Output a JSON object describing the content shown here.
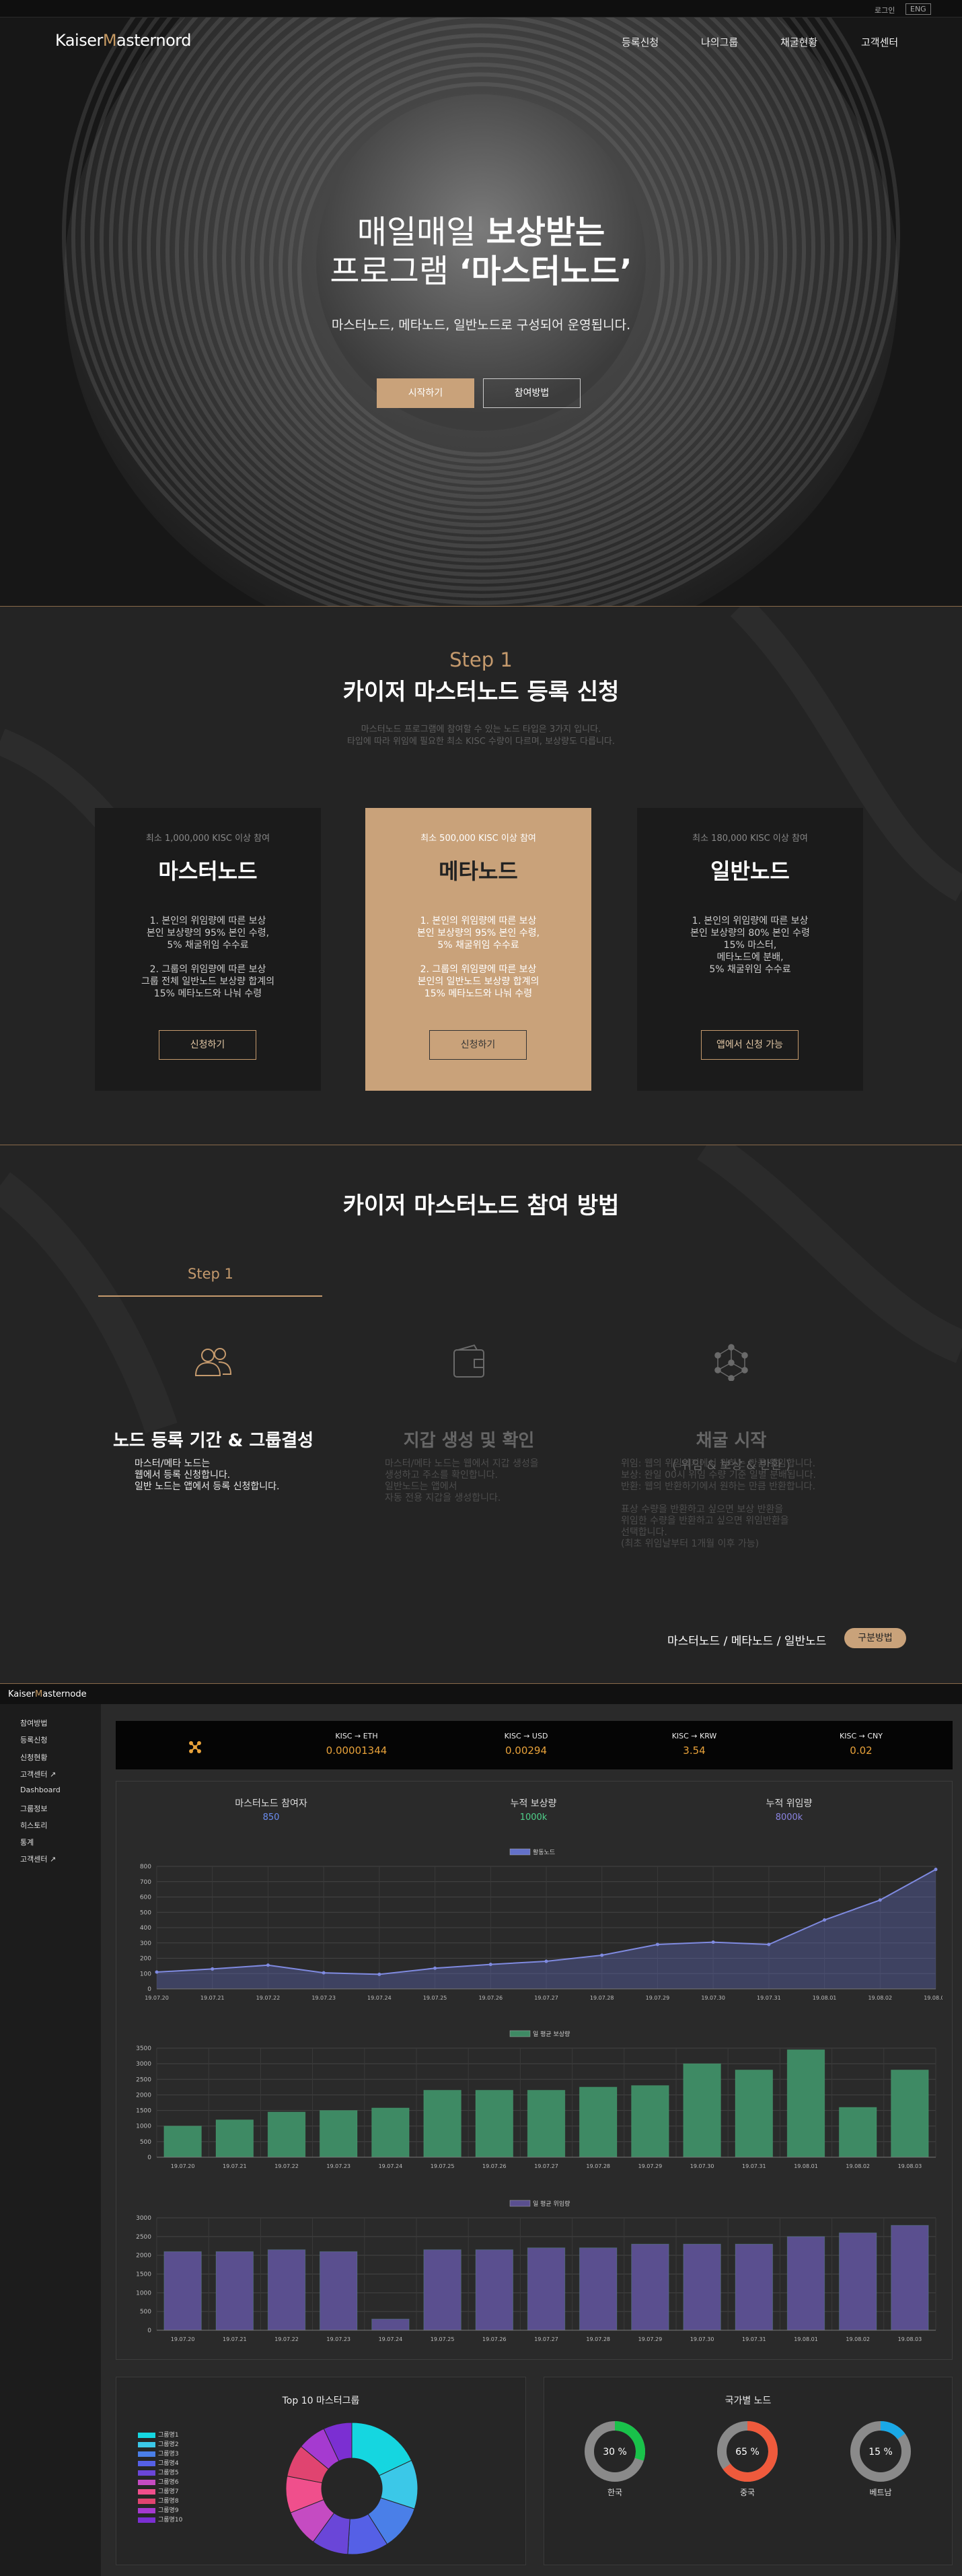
{
  "hero": {
    "top_links": {
      "login": "로그인",
      "lang": "ENG"
    },
    "brand": {
      "first": "Kaiser",
      "accent": "M",
      "rest": "asternord"
    },
    "nav": [
      "등록신청",
      "나의그룹",
      "채굴현황",
      "고객센터"
    ],
    "title_line1_light": "매일매일 ",
    "title_line1_bold": "보상받는",
    "title_line2_light": "프로그램 ",
    "title_line2_bold": "‘마스터노드’",
    "subtitle": "마스터노드, 메타노드, 일반노드로 구성되어 운영됩니다.",
    "btn_start": "시작하기",
    "btn_how": "참여방법"
  },
  "register": {
    "step": "Step 1",
    "title": "카이저 마스터노드 등록 신청",
    "desc1": "마스터노드 프로그램에 참여할 수 있는 노드 타입은 3가지 입니다.",
    "desc2": "타입에 따라 위임에 필요한 최소 KISC 수량이 다르며, 보상량도 다릅니다.",
    "cards": [
      {
        "min": "최소 1,000,000 KISC 이상 참여",
        "name": "마스터노드",
        "lines": [
          "1. 본인의 위임량에 따른 보상",
          "본인 보상량의 95% 본인 수령,",
          "5% 채굴위임 수수료",
          "",
          "2. 그룹의 위임량에 따른 보상",
          "그룹 전체 일반노드 보상량 합계의",
          "15% 메타노드와 나눠 수령"
        ],
        "btn": "신청하기"
      },
      {
        "min": "최소 500,000 KISC 이상 참여",
        "name": "메타노드",
        "lines": [
          "1. 본인의 위임량에 따른 보상",
          "본인 보상량의 95% 본인 수령,",
          "5% 채굴위임 수수료",
          "",
          "2. 그룹의 위임량에 따른 보상",
          "본인의 일반노드 보상량 합계의",
          "15% 메타노드와 나눠 수령"
        ],
        "btn": "신청하기"
      },
      {
        "min": "최소 180,000 KISC 이상 참여",
        "name": "일반노드",
        "lines": [
          "1. 본인의 위임량에 따른 보상",
          "본인 보상량의 80% 본인 수령",
          "15% 마스터,",
          "메타노드에 분배,",
          "5% 채굴위임 수수료"
        ],
        "btn": "앱에서 신청 가능"
      }
    ]
  },
  "howto": {
    "title": "카이저 마스터노드 참여 방법",
    "tab": "Step 1",
    "cols": [
      {
        "icon": "users-icon",
        "title": "노드 등록 기간 & 그룹결성",
        "sub": "",
        "lines": [
          "마스터/메타 노드는",
          "웹에서 등록 신청합니다.",
          "일반 노드는 앱에서 등록 신청합니다."
        ]
      },
      {
        "icon": "wallet-icon",
        "title": "지갑 생성 및 확인",
        "sub": "",
        "lines": [
          "마스터/메타 노드는 웹에서 지갑 생성을",
          "생성하고 주소를 확인합니다.",
          "일반노드는 앱에서",
          "자동 전용 지갑을 생성합니다."
        ]
      },
      {
        "icon": "network-icon",
        "title": "채굴 시작",
        "sub": "( 위임 & 보상 & 반환 )",
        "lines": [
          "위임: 웹의 위임하기에서 원하는 만큼 위임합니다.",
          "보상: 완일 00시 위임 수량 기준 일별 분배됩니다.",
          "반환: 웹의 반환하기에서 원하는 만큼 반환합니다.",
          "",
          "표상 수량을 반환하고 싶으면 보상 반환을",
          "위임한 수량을 반환하고 싶으면 위임반환을",
          "선택합니다.",
          "(최초 위임날부터 1개월 이후 가능)"
        ]
      }
    ],
    "types": "마스터노드 / 메타노드 / 일반노드",
    "types_btn": "구분방법"
  },
  "dashboard": {
    "brand": {
      "first": "Kaiser",
      "accent": "M",
      "rest": "asternode"
    },
    "sidebar": [
      "참여방법",
      "등록신청",
      "신청현황",
      "고객센터 ↗",
      "Dashboard",
      "그룹정보",
      "히스토리",
      "통계",
      "고객센터 ↗"
    ],
    "ticker": [
      {
        "pair": "KISC → ETH",
        "value": "0.00001344"
      },
      {
        "pair": "KISC → USD",
        "value": "0.00294"
      },
      {
        "pair": "KISC → KRW",
        "value": "3.54"
      },
      {
        "pair": "KISC → CNY",
        "value": "0.02"
      }
    ],
    "stats": [
      {
        "label": "마스터노드 참여자",
        "value": "850",
        "color": "#6b8df0"
      },
      {
        "label": "누적 보상량",
        "value": "1000k",
        "color": "#4fd08a"
      },
      {
        "label": "누적 위임량",
        "value": "8000k",
        "color": "#8a83e0"
      }
    ],
    "top10_title": "Top 10 마스터그룹",
    "country_title": "국가별 노드",
    "donuts": [
      {
        "name": "한국",
        "pct": 30,
        "label": "30 %",
        "color": "#19c24a"
      },
      {
        "name": "중국",
        "pct": 65,
        "label": "65 %",
        "color": "#ef5a3c"
      },
      {
        "name": "베트남",
        "pct": 15,
        "label": "15 %",
        "color": "#1aa8e6"
      }
    ]
  },
  "chart_data": [
    {
      "type": "line",
      "legend": "활동노드",
      "x": [
        "19.07.20",
        "19.07.21",
        "19.07.22",
        "19.07.23",
        "19.07.24",
        "19.07.25",
        "19.07.26",
        "19.07.27",
        "19.07.28",
        "19.07.29",
        "19.07.30",
        "19.07.31",
        "19.08.01",
        "19.08.02",
        "19.08.03"
      ],
      "values": [
        110,
        130,
        155,
        105,
        95,
        135,
        160,
        180,
        220,
        290,
        305,
        290,
        450,
        580,
        780
      ],
      "ylim": [
        0,
        800
      ],
      "yticks": [
        0,
        100,
        200,
        300,
        400,
        500,
        600,
        700,
        800
      ],
      "color": "#6371c9"
    },
    {
      "type": "bar",
      "legend": "일 평균 보상량",
      "x": [
        "19.07.20",
        "19.07.21",
        "19.07.22",
        "19.07.23",
        "19.07.24",
        "19.07.25",
        "19.07.26",
        "19.07.27",
        "19.07.28",
        "19.07.29",
        "19.07.30",
        "19.07.31",
        "19.08.01",
        "19.08.02",
        "19.08.03"
      ],
      "values": [
        1000,
        1200,
        1450,
        1500,
        1580,
        2150,
        2150,
        2150,
        2250,
        2300,
        3000,
        2800,
        3450,
        1600,
        2800
      ],
      "ylim": [
        0,
        3500
      ],
      "yticks": [
        0,
        500,
        1000,
        1500,
        2000,
        2500,
        3000,
        3500
      ],
      "color": "#3e8a64"
    },
    {
      "type": "bar",
      "legend": "일 평균 위임량",
      "x": [
        "19.07.20",
        "19.07.21",
        "19.07.22",
        "19.07.23",
        "19.07.24",
        "19.07.25",
        "19.07.26",
        "19.07.27",
        "19.07.28",
        "19.07.29",
        "19.07.30",
        "19.07.31",
        "19.08.01",
        "19.08.02",
        "19.08.03"
      ],
      "values": [
        2100,
        2100,
        2150,
        2100,
        300,
        2150,
        2150,
        2200,
        2200,
        2300,
        2300,
        2300,
        2500,
        2600,
        2800
      ],
      "ylim": [
        0,
        3000
      ],
      "yticks": [
        0,
        500,
        1000,
        1500,
        2000,
        2500,
        3000
      ],
      "color": "#5a4f8f"
    },
    {
      "type": "pie",
      "title": "Top 10 마스터그룹",
      "labels": [
        "그룹명1",
        "그룹명2",
        "그룹명3",
        "그룹명4",
        "그룹명5",
        "그룹명6",
        "그룹명7",
        "그룹명8",
        "그룹명9",
        "그룹명10"
      ],
      "values": [
        18,
        12,
        11,
        10,
        9,
        9,
        9,
        8,
        7,
        7
      ],
      "colors": [
        "#15d6e0",
        "#3bc8e8",
        "#4a7fe8",
        "#5560e6",
        "#6a46d8",
        "#c54bc2",
        "#f04f8c",
        "#e04470",
        "#a53ad0",
        "#7b2fd2"
      ]
    }
  ]
}
